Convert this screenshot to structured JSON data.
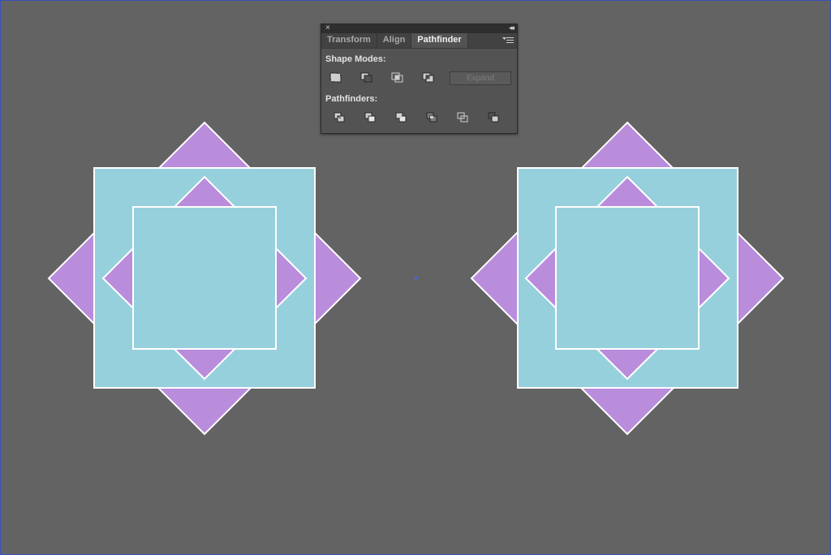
{
  "panel": {
    "close_glyph": "×",
    "collapse_glyph": "◂◂",
    "tabs": [
      {
        "label": "Transform"
      },
      {
        "label": "Align"
      },
      {
        "label": "Pathfinder",
        "active": true
      }
    ],
    "shape_modes_label": "Shape Modes:",
    "pathfinders_label": "Pathfinders:",
    "expand_label": "Expand",
    "shape_mode_icons": [
      "unite-icon",
      "minus-front-icon",
      "intersect-icon",
      "exclude-icon"
    ],
    "pathfinder_icons": [
      "divide-icon",
      "trim-icon",
      "merge-icon",
      "crop-icon",
      "outline-icon",
      "minus-back-icon"
    ]
  },
  "colors": {
    "canvas": "#636363",
    "square_fill": "#96d0dd",
    "diamond_fill": "#b98cdc",
    "stroke": "#ffffff",
    "selection_point": "#4a67e0"
  }
}
